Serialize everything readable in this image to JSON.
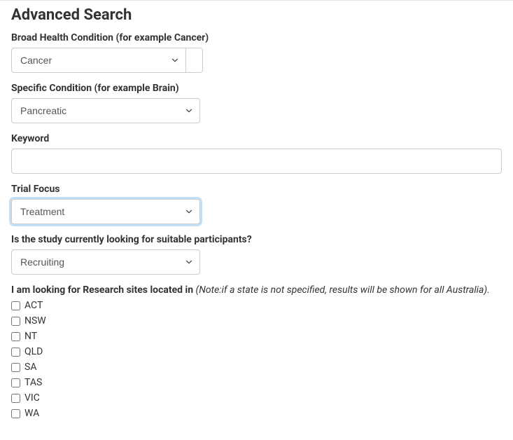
{
  "title": "Advanced Search",
  "fields": {
    "broad_condition": {
      "label": "Broad Health Condition (for example Cancer)",
      "value": "Cancer"
    },
    "specific_condition": {
      "label": "Specific Condition (for example Brain)",
      "value": "Pancreatic"
    },
    "keyword": {
      "label": "Keyword",
      "value": ""
    },
    "trial_focus": {
      "label": "Trial Focus",
      "value": "Treatment"
    },
    "recruiting": {
      "label": "Is the study currently looking for suitable participants?",
      "value": "Recruiting"
    },
    "location": {
      "label_prefix": "I am looking for Research sites located in ",
      "label_note": "(Note:if a state is not specified, results will be shown for all Australia).",
      "options": [
        {
          "label": "ACT",
          "checked": false
        },
        {
          "label": "NSW",
          "checked": false
        },
        {
          "label": "NT",
          "checked": false
        },
        {
          "label": "QLD",
          "checked": false
        },
        {
          "label": "SA",
          "checked": false
        },
        {
          "label": "TAS",
          "checked": false
        },
        {
          "label": "VIC",
          "checked": false
        },
        {
          "label": "WA",
          "checked": false
        }
      ]
    }
  }
}
